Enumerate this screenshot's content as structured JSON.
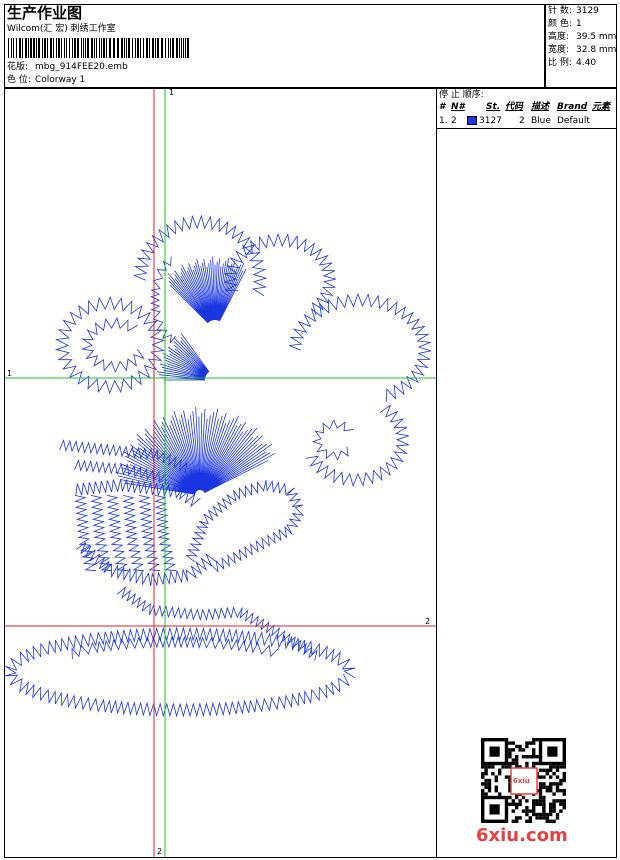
{
  "header": {
    "title": "生产作业图",
    "company": "Wilcom(汇 宏) 刺绣工作室",
    "design_label": "花版:",
    "design_value": "mbg_914FEE20.emb",
    "colorway_label": "色 位:",
    "colorway_value": "Colorway 1"
  },
  "stats": [
    {
      "label": "针 数:",
      "value": "3129"
    },
    {
      "label": "颜 色:",
      "value": "1"
    },
    {
      "label": "高度:",
      "value": "39.5 mm"
    },
    {
      "label": "宽度:",
      "value": "32.8 mm"
    },
    {
      "label": "比 例:",
      "value": "4.40"
    }
  ],
  "stop_sequence": {
    "title": "停 止 顺序:",
    "columns": [
      "#",
      "N#",
      "St.",
      "代码",
      "描述",
      "Brand",
      "元素"
    ],
    "rows": [
      {
        "num": "1.",
        "needle": "2",
        "stitches": "3127",
        "code": "2",
        "desc": "Blue",
        "brand": "Default",
        "color": "#1a36e0"
      }
    ]
  },
  "guides": {
    "v_red_label": "2",
    "v_green_label": "1",
    "h_green_label": "1",
    "h_red_label": "2"
  },
  "watermark": {
    "text": "6xiu.com",
    "qr_stamp": "6xiu"
  },
  "colors": {
    "stitch": "#1a36e0",
    "guide_red": "#e02020",
    "guide_green": "#20c020",
    "logo_red": "#e84040"
  }
}
